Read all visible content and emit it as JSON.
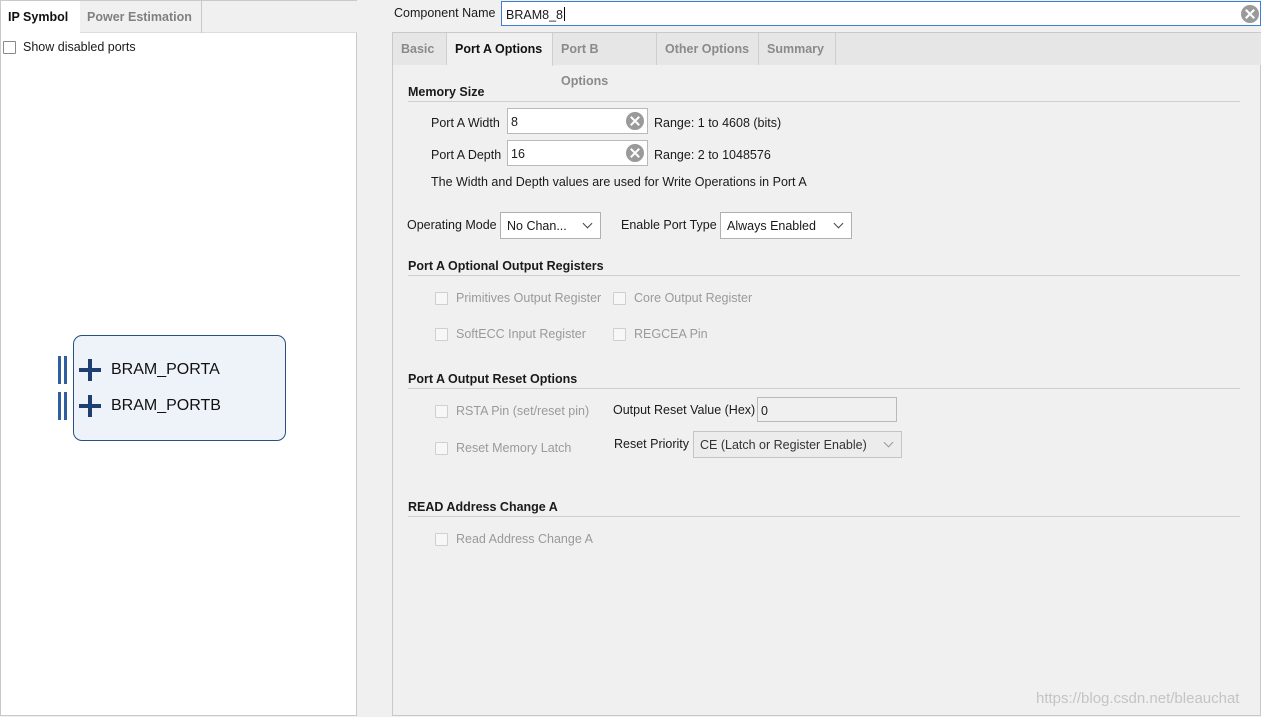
{
  "left_panel": {
    "tabs": [
      "IP Symbol",
      "Power Estimation"
    ],
    "show_disabled_ports_label": "Show disabled ports",
    "show_disabled_ports_checked": false,
    "ports": [
      "BRAM_PORTA",
      "BRAM_PORTB"
    ]
  },
  "component_name": {
    "label": "Component Name",
    "value": "BRAM8_8"
  },
  "tabs": [
    "Basic",
    "Port A Options",
    "Port B Options",
    "Other Options",
    "Summary"
  ],
  "active_tab": "Port A Options",
  "memory_size": {
    "title": "Memory Size",
    "width_label": "Port A Width",
    "width_value": "8",
    "width_range": "Range: 1 to 4608 (bits)",
    "depth_label": "Port A Depth",
    "depth_value": "16",
    "depth_range": "Range: 2 to 1048576",
    "note": "The Width and Depth values are used for Write Operations in Port A"
  },
  "operating_mode": {
    "label": "Operating Mode",
    "value": "No Chan..."
  },
  "enable_port_type": {
    "label": "Enable Port Type",
    "value": "Always Enabled"
  },
  "optional_output_registers": {
    "title": "Port A Optional Output Registers",
    "primitives_output_register": "Primitives Output Register",
    "core_output_register": "Core Output Register",
    "softecc_input_register": "SoftECC Input Register",
    "regcea_pin": "REGCEA Pin"
  },
  "output_reset_options": {
    "title": "Port A Output Reset Options",
    "rsta_pin": "RSTA Pin (set/reset pin)",
    "output_reset_value_label": "Output Reset Value (Hex)",
    "output_reset_value": "0",
    "reset_memory_latch": "Reset Memory Latch",
    "reset_priority_label": "Reset Priority",
    "reset_priority_value": "CE (Latch or Register Enable)"
  },
  "read_address_change": {
    "title": "READ Address Change A",
    "read_address_change_a": "Read Address Change A"
  },
  "watermark": "https://blog.csdn.net/bleauchat",
  "colors": {
    "accent_border": "#3c7fd4",
    "block_border": "#2a4f86",
    "block_fill": "#eef3f9"
  }
}
